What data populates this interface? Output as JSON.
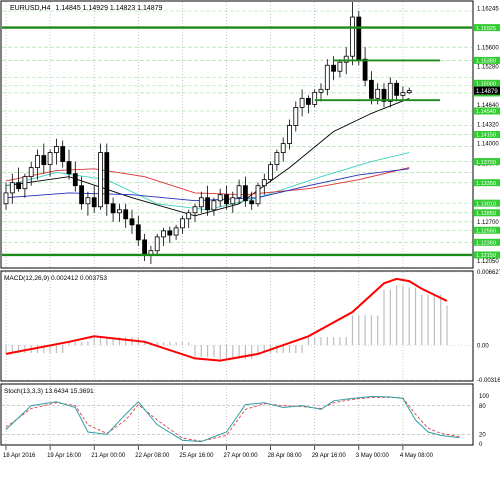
{
  "header": {
    "symbol_label": "EURUSD,H4",
    "ohlc_label": "1.14845 1.14929 1.14823 1.14879"
  },
  "price_axis": {
    "ticks": [
      "1.16245",
      "1.15925",
      "1.15600",
      "1.15280",
      "1.14960",
      "1.14640",
      "1.14320",
      "1.14000",
      "1.13670",
      "1.13350",
      "1.13025",
      "1.12700",
      "1.12380",
      "1.12050"
    ],
    "current_price": "1.14879",
    "line_labels": [
      "1.16500",
      "1.15925",
      "1.15380",
      "1.15000",
      "1.14840",
      "1.14540",
      "1.14150",
      "1.13700",
      "1.13350",
      "1.13010",
      "1.12850",
      "1.12560",
      "1.12360",
      "1.12150"
    ]
  },
  "macd": {
    "label": "MACD(12,26,9) 0.002412 0.003753",
    "ticks": [
      "0.006627",
      "0.00",
      "-0.003162"
    ]
  },
  "stoch": {
    "label": "Stoch(13,3,3) 13.6434 15.3691",
    "ticks": [
      "100",
      "80",
      "20",
      "0"
    ]
  },
  "time_axis": [
    "18 Apr 2016",
    "19 Apr 16:00",
    "21 Apr 00:00",
    "22 Apr 08:00",
    "25 Apr 16:00",
    "27 Apr 00:00",
    "28 Apr 08:00",
    "29 Apr 16:00",
    "3 May 00:00",
    "4 May 08:00"
  ],
  "colors": {
    "background": "#ffffff",
    "frame": "#000000",
    "grid": "#b0b0b0",
    "level_line": "#1a8a1a",
    "level_grid": "#b7e6b7",
    "label_fill": "#33cc33",
    "candle": "#000000",
    "ma_black": "#000000",
    "ma_blue": "#1f2fbf",
    "ma_red": "#e03030",
    "ma_cyan": "#40d0c0",
    "macd_line": "#ff0000",
    "macd_hist": "#bdbdbd",
    "stoch_main": "#30a0a8",
    "stoch_signal": "#e04040"
  },
  "chart_data": {
    "type": "candlestick",
    "title": "EURUSD,H4",
    "timeframe": "H4",
    "last_bar": {
      "open": 1.14845,
      "high": 1.14929,
      "low": 1.14823,
      "close": 1.14879
    },
    "ylim": [
      1.1195,
      1.1635
    ],
    "x_tick_labels": [
      "18 Apr 2016",
      "19 Apr 16:00",
      "21 Apr 00:00",
      "22 Apr 08:00",
      "25 Apr 16:00",
      "27 Apr 00:00",
      "28 Apr 08:00",
      "29 Apr 16:00",
      "3 May 00:00",
      "4 May 08:00"
    ],
    "horizontal_levels": [
      1.1215,
      1.15925,
      1.1538,
      1.1472
    ],
    "candles": [
      [
        1.13,
        1.1335,
        1.129,
        1.1318
      ],
      [
        1.1318,
        1.135,
        1.13,
        1.1335
      ],
      [
        1.1335,
        1.136,
        1.132,
        1.1325
      ],
      [
        1.1325,
        1.135,
        1.131,
        1.1345
      ],
      [
        1.1345,
        1.137,
        1.133,
        1.136
      ],
      [
        1.136,
        1.139,
        1.134,
        1.138
      ],
      [
        1.138,
        1.14,
        1.135,
        1.1365
      ],
      [
        1.1365,
        1.139,
        1.1345,
        1.1385
      ],
      [
        1.1385,
        1.1408,
        1.1365,
        1.1395
      ],
      [
        1.1395,
        1.1405,
        1.136,
        1.137
      ],
      [
        1.137,
        1.139,
        1.134,
        1.135
      ],
      [
        1.135,
        1.137,
        1.132,
        1.133
      ],
      [
        1.133,
        1.1345,
        1.129,
        1.13
      ],
      [
        1.13,
        1.132,
        1.128,
        1.131
      ],
      [
        1.131,
        1.133,
        1.1285,
        1.1295
      ],
      [
        1.1295,
        1.14,
        1.129,
        1.1385
      ],
      [
        1.1385,
        1.14,
        1.128,
        1.13
      ],
      [
        1.13,
        1.131,
        1.127,
        1.1285
      ],
      [
        1.1285,
        1.13,
        1.127,
        1.129
      ],
      [
        1.129,
        1.13,
        1.126,
        1.1275
      ],
      [
        1.1275,
        1.129,
        1.125,
        1.1265
      ],
      [
        1.1265,
        1.128,
        1.123,
        1.124
      ],
      [
        1.124,
        1.125,
        1.1205,
        1.1215
      ],
      [
        1.1215,
        1.123,
        1.12,
        1.1222
      ],
      [
        1.1222,
        1.125,
        1.1215,
        1.1245
      ],
      [
        1.1245,
        1.126,
        1.123,
        1.1255
      ],
      [
        1.1255,
        1.1262,
        1.1235,
        1.1248
      ],
      [
        1.1248,
        1.1265,
        1.124,
        1.126
      ],
      [
        1.126,
        1.128,
        1.125,
        1.1275
      ],
      [
        1.1275,
        1.129,
        1.126,
        1.1285
      ],
      [
        1.1285,
        1.13,
        1.127,
        1.1295
      ],
      [
        1.1295,
        1.132,
        1.1285,
        1.131
      ],
      [
        1.131,
        1.133,
        1.128,
        1.129
      ],
      [
        1.129,
        1.131,
        1.128,
        1.1305
      ],
      [
        1.1305,
        1.1325,
        1.1295,
        1.1315
      ],
      [
        1.1315,
        1.133,
        1.129,
        1.13
      ],
      [
        1.13,
        1.132,
        1.1285,
        1.131
      ],
      [
        1.131,
        1.134,
        1.13,
        1.133
      ],
      [
        1.133,
        1.1345,
        1.1295,
        1.1305
      ],
      [
        1.1305,
        1.132,
        1.129,
        1.13
      ],
      [
        1.13,
        1.1335,
        1.1295,
        1.133
      ],
      [
        1.133,
        1.135,
        1.1315,
        1.134
      ],
      [
        1.134,
        1.137,
        1.1335,
        1.1365
      ],
      [
        1.1365,
        1.139,
        1.1355,
        1.1385
      ],
      [
        1.1385,
        1.141,
        1.137,
        1.14
      ],
      [
        1.14,
        1.144,
        1.139,
        1.143
      ],
      [
        1.143,
        1.147,
        1.142,
        1.146
      ],
      [
        1.146,
        1.149,
        1.1445,
        1.1475
      ],
      [
        1.1475,
        1.148,
        1.145,
        1.1465
      ],
      [
        1.1465,
        1.149,
        1.146,
        1.1485
      ],
      [
        1.1485,
        1.15,
        1.147,
        1.149
      ],
      [
        1.149,
        1.154,
        1.148,
        1.153
      ],
      [
        1.153,
        1.1545,
        1.1505,
        1.152
      ],
      [
        1.152,
        1.154,
        1.151,
        1.1535
      ],
      [
        1.1535,
        1.156,
        1.1515,
        1.1545
      ],
      [
        1.1545,
        1.1635,
        1.153,
        1.161
      ],
      [
        1.161,
        1.162,
        1.153,
        1.154
      ],
      [
        1.154,
        1.156,
        1.1495,
        1.1505
      ],
      [
        1.1505,
        1.152,
        1.1465,
        1.1475
      ],
      [
        1.1475,
        1.15,
        1.1465,
        1.149
      ],
      [
        1.149,
        1.15,
        1.146,
        1.147
      ],
      [
        1.147,
        1.151,
        1.146,
        1.15
      ],
      [
        1.15,
        1.1505,
        1.147,
        1.148
      ],
      [
        1.148,
        1.1495,
        1.147,
        1.14845
      ],
      [
        1.14845,
        1.14929,
        1.14823,
        1.14879
      ]
    ],
    "moving_averages": [
      {
        "color": "black",
        "values": [
          [
            0,
            1.133
          ],
          [
            10,
            1.1345
          ],
          [
            20,
            1.131
          ],
          [
            30,
            1.128
          ],
          [
            37,
            1.13
          ],
          [
            45,
            1.136
          ],
          [
            52,
            1.142
          ],
          [
            58,
            1.145
          ],
          [
            64,
            1.1475
          ]
        ]
      },
      {
        "color": "cyan",
        "values": [
          [
            0,
            1.133
          ],
          [
            8,
            1.1352
          ],
          [
            16,
            1.134
          ],
          [
            24,
            1.13
          ],
          [
            32,
            1.129
          ],
          [
            40,
            1.131
          ],
          [
            50,
            1.1345
          ],
          [
            58,
            1.137
          ],
          [
            64,
            1.1385
          ]
        ]
      },
      {
        "color": "red",
        "values": [
          [
            0,
            1.1338
          ],
          [
            8,
            1.1355
          ],
          [
            14,
            1.1358
          ],
          [
            22,
            1.1345
          ],
          [
            30,
            1.1318
          ],
          [
            38,
            1.1315
          ],
          [
            48,
            1.1325
          ],
          [
            56,
            1.134
          ],
          [
            64,
            1.136
          ]
        ]
      },
      {
        "color": "blue",
        "values": [
          [
            0,
            1.131
          ],
          [
            10,
            1.1318
          ],
          [
            20,
            1.1315
          ],
          [
            30,
            1.1305
          ],
          [
            40,
            1.131
          ],
          [
            48,
            1.133
          ],
          [
            56,
            1.1348
          ],
          [
            64,
            1.1358
          ]
        ]
      }
    ],
    "macd": {
      "ylim": [
        -0.003162,
        0.006627
      ],
      "signal": [
        [
          0,
          -0.0008
        ],
        [
          10,
          0.0003
        ],
        [
          14,
          0.0008
        ],
        [
          22,
          0.0003
        ],
        [
          30,
          -0.0012
        ],
        [
          34,
          -0.0014
        ],
        [
          40,
          -0.0008
        ],
        [
          48,
          0.0008
        ],
        [
          55,
          0.003
        ],
        [
          60,
          0.0056
        ],
        [
          62,
          0.006
        ],
        [
          64,
          0.0058
        ],
        [
          66,
          0.0051
        ],
        [
          70,
          0.004
        ]
      ]
    },
    "stochastic": {
      "ylim": [
        0,
        100
      ],
      "main": [
        [
          0,
          30
        ],
        [
          4,
          80
        ],
        [
          8,
          88
        ],
        [
          11,
          76
        ],
        [
          13,
          25
        ],
        [
          16,
          20
        ],
        [
          19,
          62
        ],
        [
          21,
          88
        ],
        [
          24,
          40
        ],
        [
          28,
          8
        ],
        [
          31,
          5
        ],
        [
          35,
          25
        ],
        [
          38,
          82
        ],
        [
          41,
          86
        ],
        [
          44,
          76
        ],
        [
          47,
          80
        ],
        [
          50,
          72
        ],
        [
          52,
          90
        ],
        [
          55,
          95
        ],
        [
          58,
          99
        ],
        [
          61,
          98
        ],
        [
          63,
          95
        ],
        [
          65,
          50
        ],
        [
          67,
          25
        ],
        [
          69,
          18
        ],
        [
          72,
          13
        ]
      ],
      "signal": [
        [
          0,
          35
        ],
        [
          4,
          74
        ],
        [
          8,
          86
        ],
        [
          11,
          80
        ],
        [
          13,
          40
        ],
        [
          16,
          22
        ],
        [
          19,
          50
        ],
        [
          21,
          82
        ],
        [
          24,
          50
        ],
        [
          28,
          12
        ],
        [
          31,
          6
        ],
        [
          35,
          18
        ],
        [
          38,
          72
        ],
        [
          41,
          84
        ],
        [
          44,
          80
        ],
        [
          47,
          78
        ],
        [
          50,
          74
        ],
        [
          52,
          86
        ],
        [
          55,
          93
        ],
        [
          58,
          97
        ],
        [
          61,
          97
        ],
        [
          63,
          96
        ],
        [
          65,
          62
        ],
        [
          67,
          33
        ],
        [
          69,
          22
        ],
        [
          72,
          15
        ]
      ]
    }
  }
}
